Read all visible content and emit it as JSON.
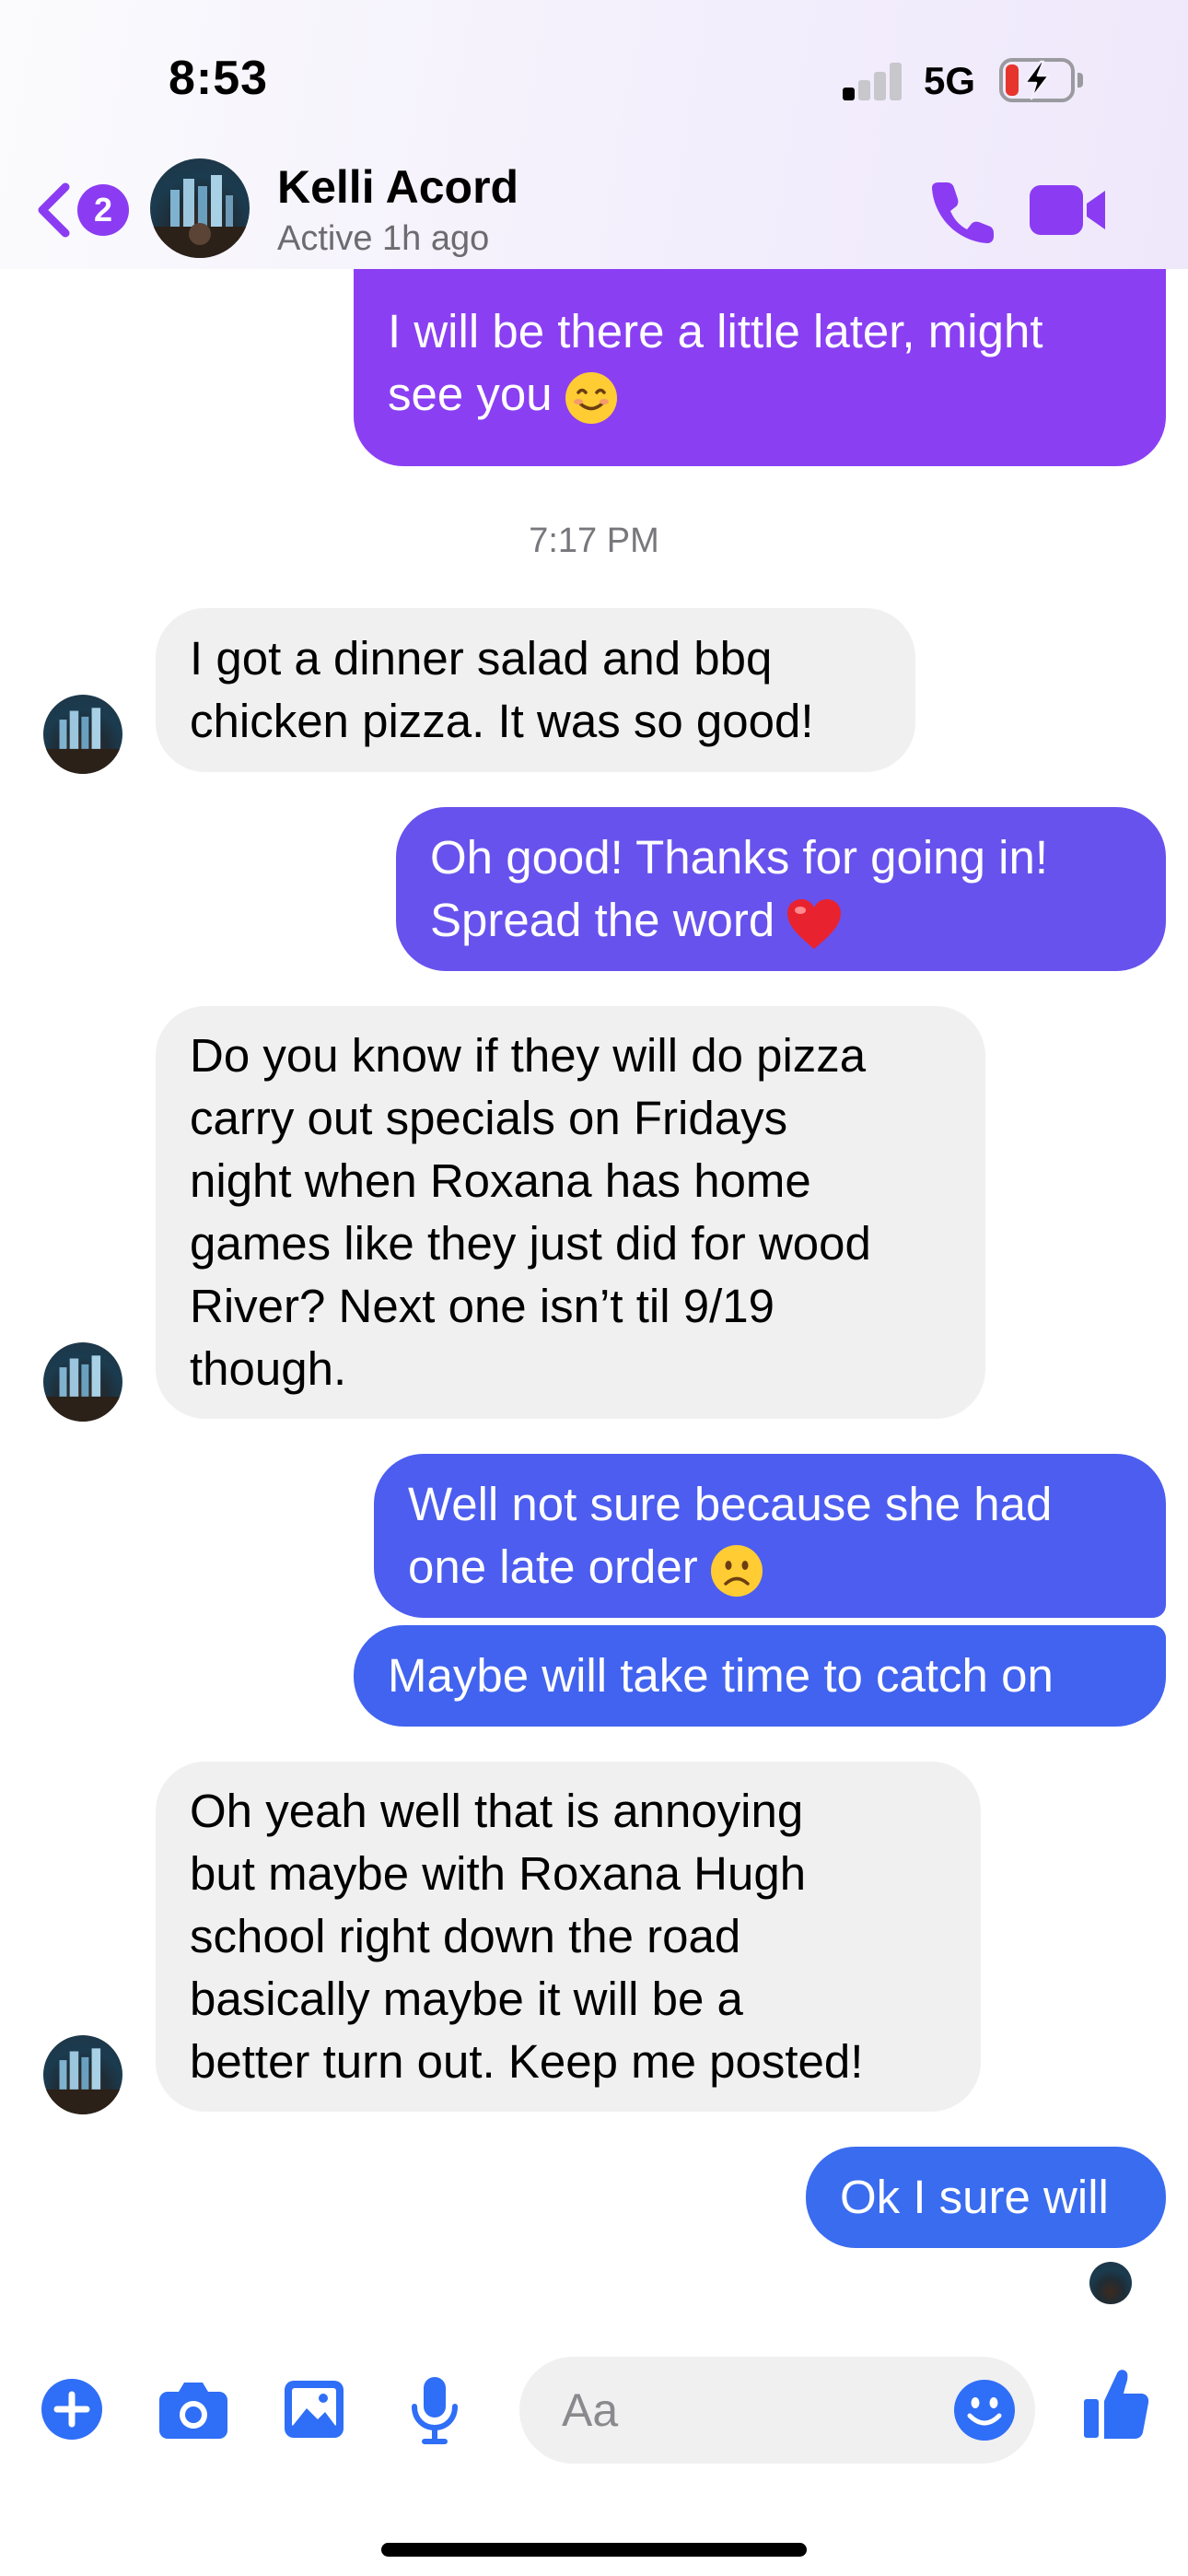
{
  "status_bar": {
    "time": "8:53",
    "network": "5G"
  },
  "header": {
    "back_badge_count": "2",
    "contact_name": "Kelli Acord",
    "contact_status": "Active 1h ago"
  },
  "colors": {
    "accent_purple": "#8b3cf2",
    "bubble_out_top": "#8a3ff3",
    "bubble_out_bottom": "#3a6cf0",
    "bubble_in": "#f0f0f0",
    "composer_blue": "#2f6ef6"
  },
  "messages": [
    {
      "side": "outgoing",
      "lines": [
        "I will be there a little later, might",
        "see you"
      ],
      "emoji": "smiling-face"
    },
    {
      "side": "timestamp",
      "text": "7:17 PM"
    },
    {
      "side": "incoming",
      "lines": [
        "I got a dinner salad and bbq",
        "chicken pizza. It was so good!"
      ]
    },
    {
      "side": "outgoing",
      "lines": [
        "Oh good! Thanks for going in!",
        "Spread the word"
      ],
      "emoji": "red-heart"
    },
    {
      "side": "incoming",
      "lines": [
        "Do you know if they will do pizza",
        "carry out specials on Fridays",
        "night when Roxana has home",
        "games like they just did for wood",
        "River? Next one isn’t til 9/19",
        "though."
      ]
    },
    {
      "side": "outgoing",
      "lines": [
        "Well not sure because she had",
        "one late order"
      ],
      "emoji": "frowning-face"
    },
    {
      "side": "outgoing",
      "lines": [
        "Maybe will take time to catch on"
      ]
    },
    {
      "side": "incoming",
      "lines": [
        "Oh yeah well that is annoying",
        "but maybe with Roxana Hugh",
        "school right down the road",
        "basically maybe it will be a",
        "better turn out. Keep me posted!"
      ]
    },
    {
      "side": "outgoing",
      "lines": [
        "Ok I sure will"
      ]
    }
  ],
  "composer": {
    "placeholder": "Aa",
    "icons": [
      "plus-icon",
      "camera-icon",
      "image-icon",
      "microphone-icon",
      "emoji-icon",
      "thumbs-up-icon"
    ]
  }
}
